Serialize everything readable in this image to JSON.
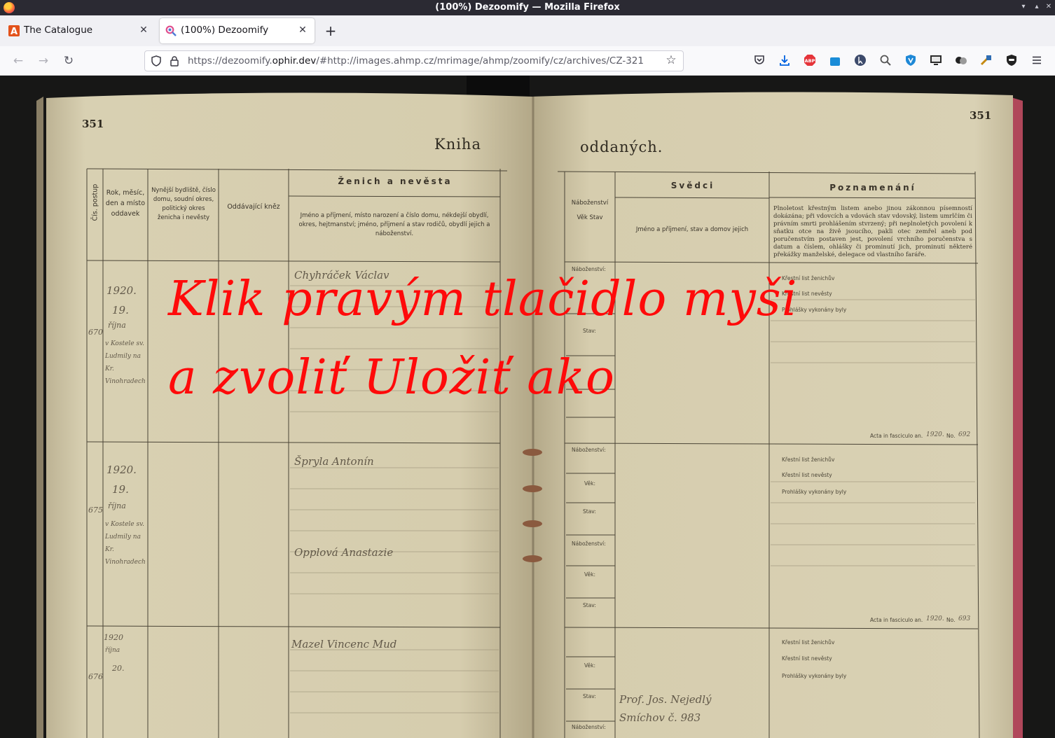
{
  "window": {
    "title": "(100%) Dezoomify — Mozilla Firefox"
  },
  "tabs": [
    {
      "label": "The Catalogue",
      "favicon": "catalogue-a-icon"
    },
    {
      "label": "(100%) Dezoomify",
      "favicon": "dezoomify-magnifier-icon",
      "active": true
    }
  ],
  "urlbar": {
    "prefix": "https://dezoomify.",
    "host": "ophir.dev",
    "rest": "/#http://images.ahmp.cz/mrimage/ahmp/zoomify/cz/archives/CZ-321"
  },
  "extensions": [
    "pocket-icon",
    "download-icon",
    "adblock-icon",
    "bitwarden-icon",
    "cursor-icon",
    "zoom-icon",
    "vpn-shield-icon",
    "screen-icon",
    "toggle-icon",
    "tools-icon",
    "mask-icon",
    "menu-icon"
  ],
  "extension_badge": "1",
  "register": {
    "page_number_left": "351",
    "page_number_right": "351",
    "title_left": "Kniha",
    "title_right": "oddaných.",
    "headers": {
      "col_number": "Čís. postup",
      "col_date": "Rok, měsíc, den a místo oddavek",
      "col_residence": "Nynější bydliště, číslo domu, soudní okres, politický okres ženicha i nevěsty",
      "col_priest": "Oddávající kněz",
      "col_couple_title": "Ženich a nevěsta",
      "col_couple_sub": "Jméno a příjmení, místo narození a číslo domu, nékdejší obydlí, okres, hejtmanství; jméno, příjmení a stav rodičů, obydlí jejich a náboženství.",
      "col_religion": "Náboženství Věk Stav",
      "col_witnesses_title": "Svědci",
      "col_witnesses_sub": "Jméno a příjmení, stav a domov jejich",
      "col_notes_title": "Poznamenání",
      "col_notes_sub": "Plnoletost křestným listem anebo jinou zákonnou písemností dokázána; při vdovcích a vdovách stav vdovský, listem umrlčím či právním smrti prohlášením stvrzený; při neplnoletých povolení k sňatku otce na živě jsoucího, pakli otec zemřel aneb pod poručenstvím postaven jest, povolení vrchního poručenstva s datum a číslem, ohlášky či prominutí jich, prominutí některé překážky manželské, delegace od vlastního faráře."
    },
    "printed_labels": {
      "religion": "Náboženství:",
      "age": "Věk:",
      "status": "Stav:",
      "baptism_groom": "Křestní list ženichův",
      "baptism_bride": "Křestní list nevěsty",
      "banns": "Prohlášky vykonány byly",
      "acta": "Acta in fasciculo an.",
      "no": "No."
    },
    "entries": [
      {
        "number": "670",
        "year": "1920.",
        "day": "19.",
        "month": "října",
        "place": "v Kostele sv. Ludmily na Kr. Vinohradech",
        "groom": "Chyhráček Václav",
        "acta_year": "1920.",
        "acta_no": "692"
      },
      {
        "number": "675",
        "year": "1920.",
        "day": "19.",
        "month": "října",
        "place": "v Kostele sv. Ludmily na Kr. Vinohradech",
        "groom": "Špryla Antonín",
        "bride": "Opplová Anastazie",
        "acta_year": "1920.",
        "acta_no": "693"
      },
      {
        "number": "676",
        "year": "1920",
        "day": "20.",
        "month": "října",
        "groom": "Mazel Vincenc Mud",
        "witness": "Prof. Jos. Nejedlý Smíchov č. 983"
      }
    ]
  },
  "overlay": {
    "line1": "Klik pravým tlačidlo myši",
    "line2": "a zvoliť Uložiť ako"
  }
}
